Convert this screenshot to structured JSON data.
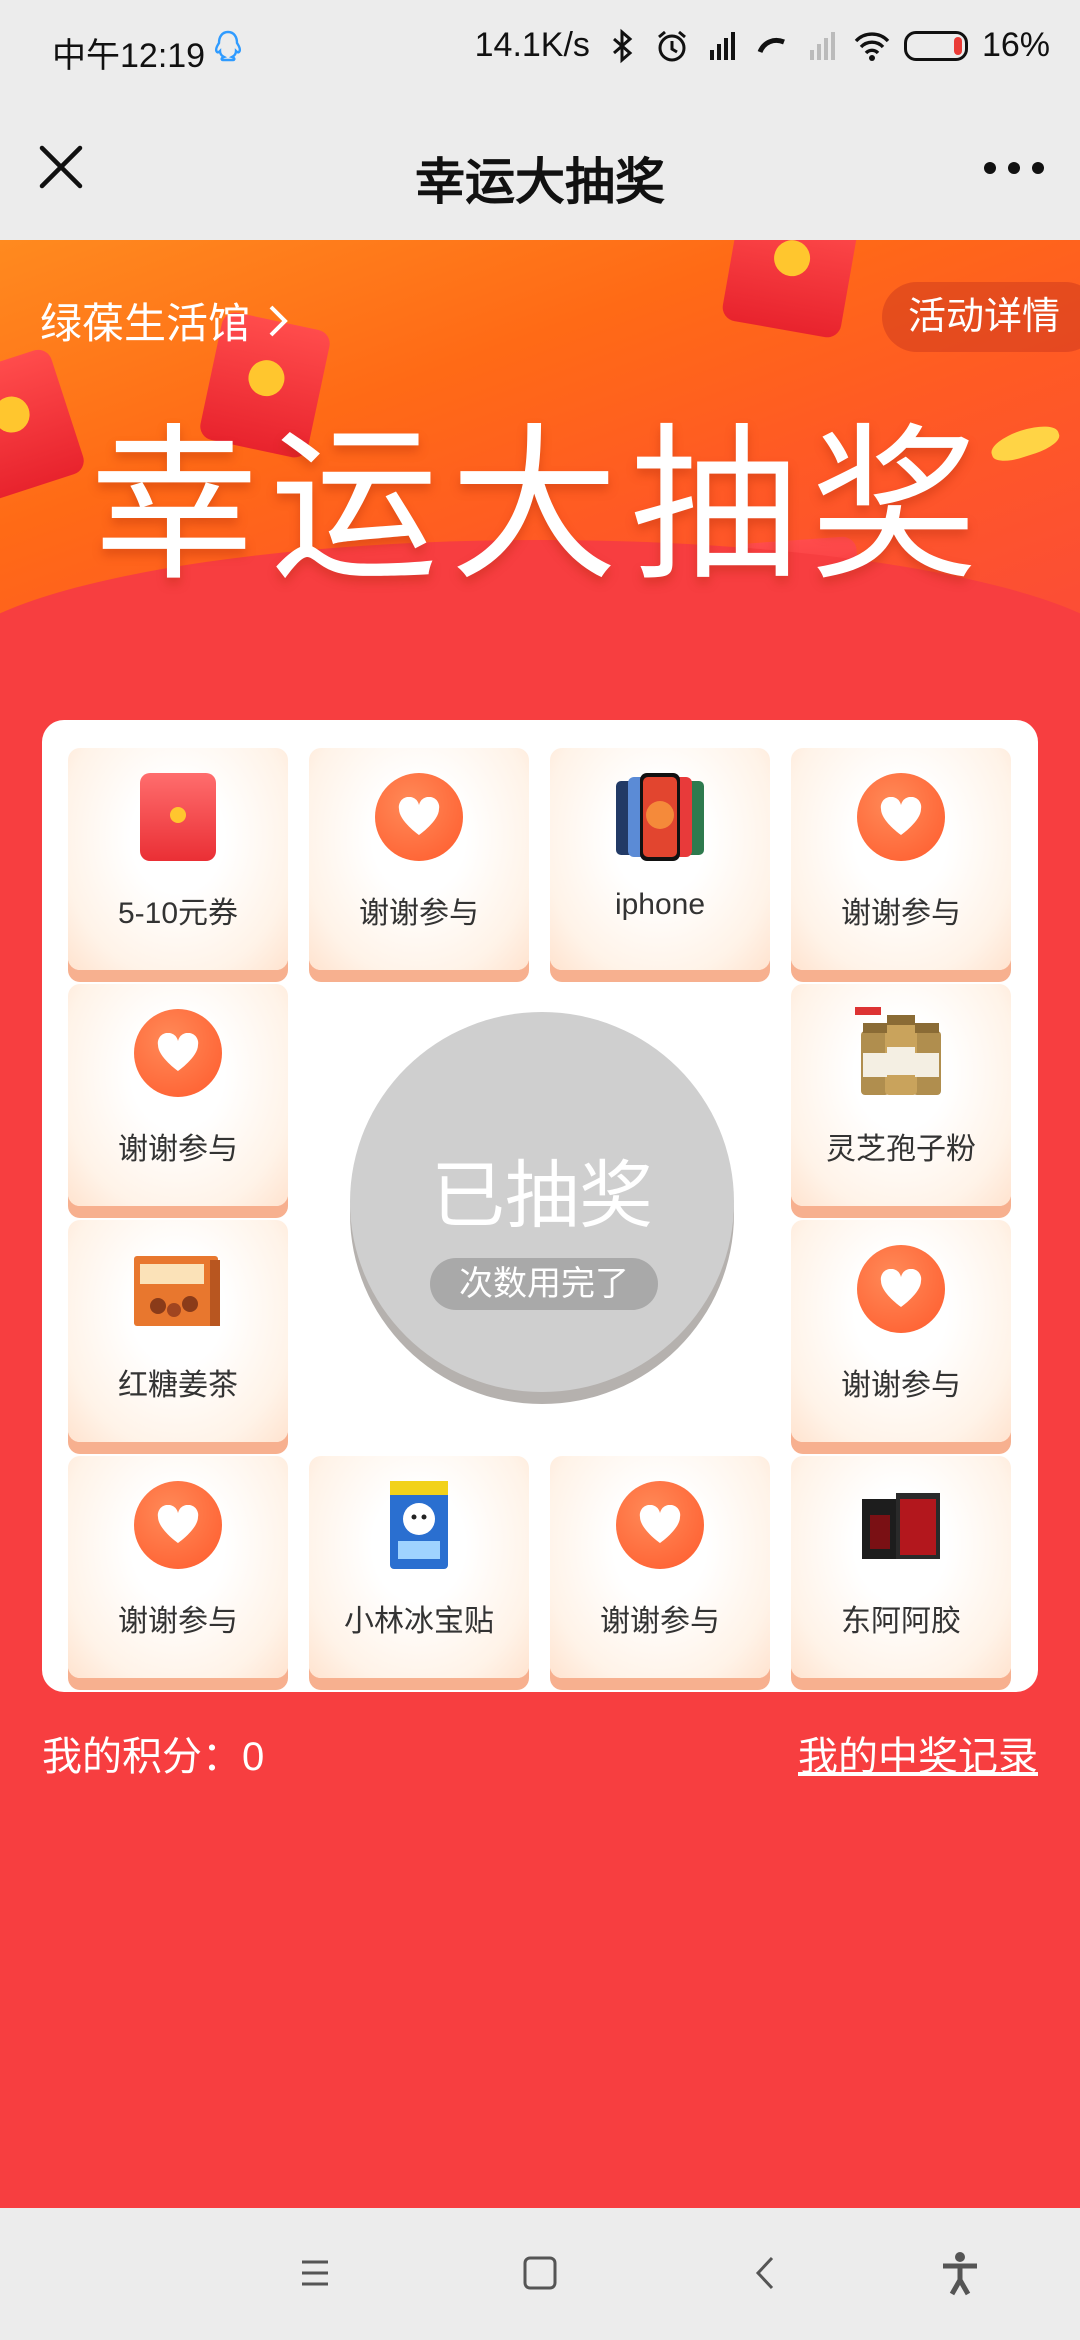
{
  "status_bar": {
    "time": "中午12:19",
    "net_speed": "14.1K/s",
    "battery": "16%",
    "battery_level": 0.16,
    "icons": [
      "qq-icon",
      "bluetooth-icon",
      "alarm-icon",
      "hd-signal-icon",
      "call-icon",
      "no-signal-icon",
      "wifi-icon",
      "battery-icon"
    ]
  },
  "nav": {
    "title": "幸运大抽奖",
    "close_icon": "close-icon",
    "more_icon": "more-icon"
  },
  "banner": {
    "store": "绿葆生活馆",
    "detail": "活动详情",
    "title": "幸运大抽奖"
  },
  "prizes": [
    {
      "label": "5-10元券",
      "icon": "red-packet-icon"
    },
    {
      "label": "谢谢参与",
      "icon": "heart-icon"
    },
    {
      "label": "iphone",
      "icon": "iphone-icon"
    },
    {
      "label": "谢谢参与",
      "icon": "heart-icon"
    },
    {
      "label": "谢谢参与",
      "icon": "heart-icon"
    },
    {
      "label": "灵芝孢子粉",
      "icon": "supplement-bottles-icon"
    },
    {
      "label": "红糖姜茶",
      "icon": "tea-box-icon"
    },
    {
      "label": "谢谢参与",
      "icon": "heart-icon"
    },
    {
      "label": "谢谢参与",
      "icon": "heart-icon"
    },
    {
      "label": "小林冰宝贴",
      "icon": "cooling-patch-icon"
    },
    {
      "label": "谢谢参与",
      "icon": "heart-icon"
    },
    {
      "label": "东阿阿胶",
      "icon": "gift-box-icon"
    }
  ],
  "draw": {
    "title": "已抽奖",
    "subtitle": "次数用完了"
  },
  "footer": {
    "points": "我的积分：0",
    "records": "我的中奖记录"
  },
  "colors": {
    "background": "#f73e40",
    "accent": "#ff5a2c",
    "button_disabled": "#cfcfcf"
  },
  "system_nav": [
    "menu-icon",
    "home-icon",
    "back-icon",
    "accessibility-icon"
  ]
}
